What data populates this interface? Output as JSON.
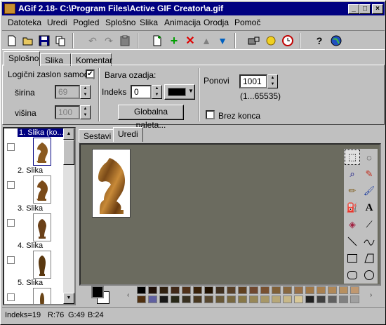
{
  "window": {
    "title": "AGif 2.18- C:\\Program Files\\Active GIF Creator\\a.gif",
    "buttons": {
      "minimize": "_",
      "maximize": "□",
      "close": "×"
    }
  },
  "menu": [
    "Datoteka",
    "Uredi",
    "Pogled",
    "Splošno",
    "Slika",
    "Animacija",
    "Orodja",
    "Pomoč"
  ],
  "toolbar": {
    "icons": [
      "new-icon",
      "open-icon",
      "save-icon",
      "copy-doc-icon",
      "undo-icon",
      "redo-icon",
      "paste-icon",
      "new-frame-icon",
      "add-icon",
      "delete-icon",
      "up-arrow-icon",
      "down-arrow-icon",
      "optimize-icon",
      "wizard-icon",
      "clock-icon",
      "help-icon",
      "globe-icon"
    ]
  },
  "tabs": {
    "general": "Splošno",
    "image": "Slika",
    "comment": "Komentar"
  },
  "general": {
    "logical_screen_label": "Logični zaslon samodej",
    "logical_screen_checked": true,
    "width_label": "širina",
    "width_value": "69",
    "height_label": "višina",
    "height_value": "100",
    "bg_color_label": "Barva ozadja:",
    "index_label": "Indeks",
    "index_value": "0",
    "bg_color": "#000000",
    "global_palette_button": "Globalna paleta...",
    "repeat_label": "Ponovi",
    "repeat_value": "1001",
    "repeat_range": "(1...65535)",
    "loop_forever_label": "Brez konca",
    "loop_forever_checked": false
  },
  "frames": {
    "items": [
      {
        "label": "1. Slika (ko..."
      },
      {
        "label": "2. Slika"
      },
      {
        "label": "3. Slika"
      },
      {
        "label": "4. Slika"
      },
      {
        "label": "5. Slika"
      }
    ]
  },
  "editor": {
    "tab_compose": "Sestavi",
    "tab_edit": "Uredi",
    "canvas_color": "#6b6b5f",
    "foreground_color": "#000000",
    "background_color": "#ffffff"
  },
  "palette": [
    "#000000",
    "#201008",
    "#302010",
    "#402818",
    "#503018",
    "#382008",
    "#201000",
    "#403020",
    "#584028",
    "#604020",
    "#704830",
    "#785030",
    "#806038",
    "#886840",
    "#987048",
    "#a07848",
    "#a88050",
    "#b08858",
    "#b89060",
    "#c09870",
    "#503010",
    "#6060a0",
    "#181818",
    "#282818",
    "#383020",
    "#483820",
    "#584830",
    "#685838",
    "#786840",
    "#887848",
    "#988858",
    "#a89868",
    "#b8a878",
    "#c8b888",
    "#d8c898",
    "#202020",
    "#404040",
    "#606060",
    "#808080",
    "#a0a0a0"
  ],
  "status": {
    "index": "Indeks=19",
    "r": "R:76",
    "g": "G:49",
    "b": "B:24"
  }
}
